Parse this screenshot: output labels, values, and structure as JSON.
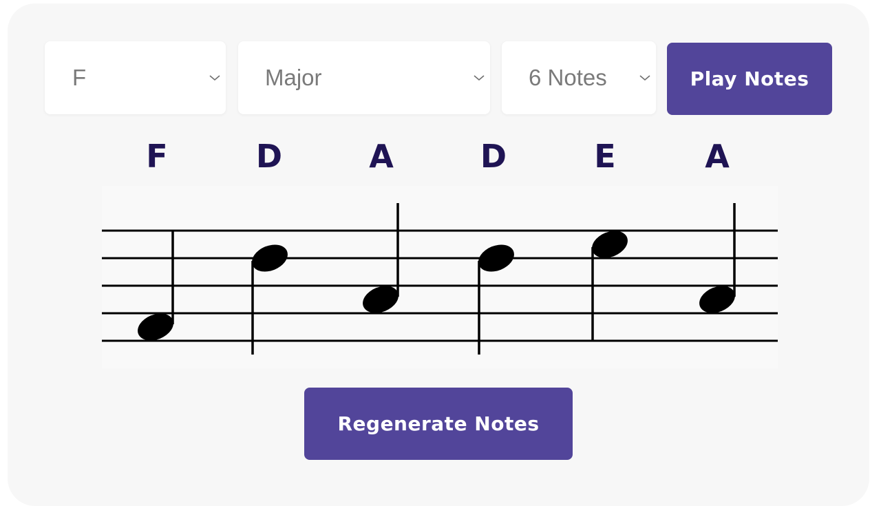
{
  "controls": {
    "key_value": "F",
    "scale_value": "Major",
    "count_value": "6 Notes",
    "play_label": "Play Notes",
    "regenerate_label": "Regenerate Notes"
  },
  "notes": [
    {
      "name": "F",
      "pitch": "F4"
    },
    {
      "name": "D",
      "pitch": "D5"
    },
    {
      "name": "A",
      "pitch": "A4"
    },
    {
      "name": "D",
      "pitch": "D5"
    },
    {
      "name": "E",
      "pitch": "E5"
    },
    {
      "name": "A",
      "pitch": "A4"
    }
  ],
  "colors": {
    "accent": "#52459a",
    "note_name": "#1f1454",
    "card_bg": "#f7f7f7"
  },
  "icons": {
    "dropdown": "chevron-down-icon",
    "note": "quarter-note-icon"
  }
}
